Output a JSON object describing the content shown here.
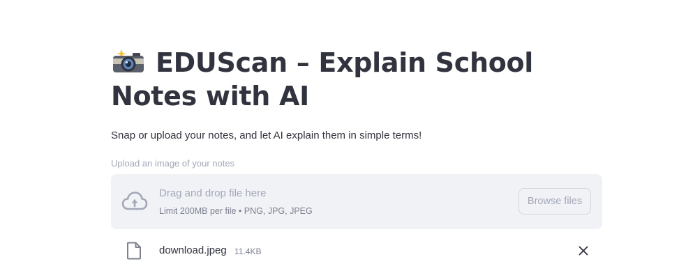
{
  "header": {
    "title_emoji_icon": "camera-with-flash-icon",
    "title": "EDUScan – Explain School Notes with AI",
    "subtitle": "Snap or upload your notes, and let AI explain them in simple terms!"
  },
  "uploader": {
    "label": "Upload an image of your notes",
    "drop_text": "Drag and drop file here",
    "limit_text": "Limit 200MB per file • PNG, JPG, JPEG",
    "browse_label": "Browse files",
    "upload_icon": "cloud-upload-icon"
  },
  "uploaded_file": {
    "name": "download.jpeg",
    "size": "11.4KB",
    "file_icon": "file-icon",
    "remove_icon": "close-icon"
  },
  "colors": {
    "text": "#31333f",
    "muted": "#a3a8b8",
    "dropzone_bg": "#f0f2f6"
  }
}
